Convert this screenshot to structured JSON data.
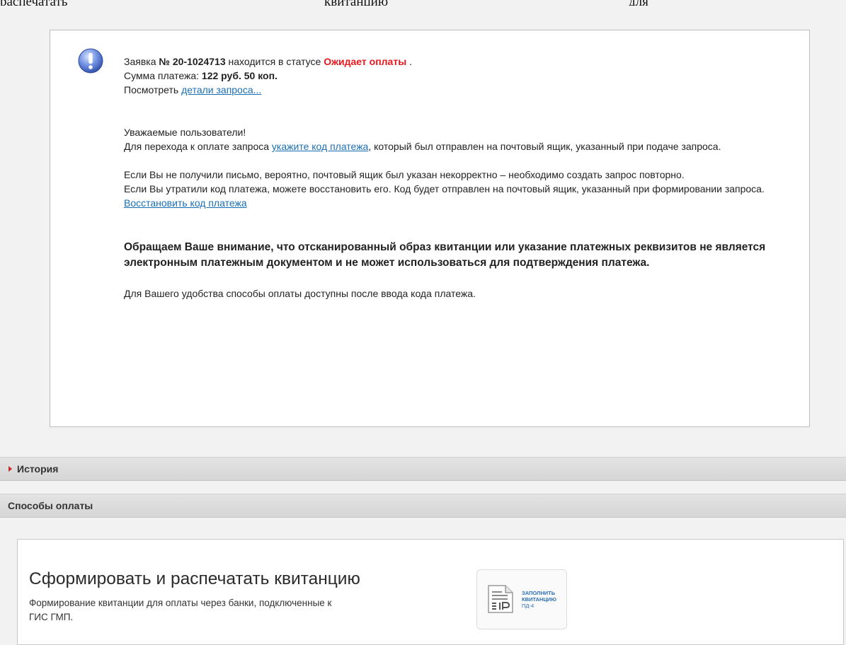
{
  "top_cut": {
    "w1": "распечатать",
    "w2": "квитанцию",
    "w3": "для"
  },
  "notice": {
    "icon": "exclamation-info-icon",
    "line1_pre": "Заявка ",
    "request_no": "№ 20-1024713",
    "line1_mid": " находится в статусе ",
    "status": "Ожидает оплаты",
    "line1_post": " .",
    "amount_label": "Сумма платежа: ",
    "amount": "122 руб. 50 коп.",
    "view_label": "Посмотреть ",
    "view_link": "детали запроса...",
    "greeting": "Уважаемые пользователи!",
    "p1_pre": "Для перехода к оплате запроса ",
    "p1_link": "укажите код платежа",
    "p1_post": ", который был отправлен на почтовый ящик, указанный при подаче запроса.",
    "p2": "Если Вы не получили письмо, вероятно, почтовый ящик был указан некорректно – необходимо создать запрос повторно.",
    "p3_pre": "Если Вы утратили код платежа, можете восстановить его. Код будет отправлен на почтовый ящик, указанный при формировании запроса. ",
    "p3_link": "Восстановить код платежа",
    "attention": "Обращаем Ваше внимание, что отсканированный образ квитанции или указание платежных реквизитов не является электронным платежным документом и не может использоваться для подтверждения платежа.",
    "note": "Для Вашего удобства способы оплаты доступны после ввода кода платежа."
  },
  "sections": {
    "history": "История",
    "payment": "Способы оплаты"
  },
  "payment_method": {
    "title": "Сформировать и распечатать квитанцию",
    "desc": "Формирование квитанции для оплаты через банки, подключенные к ГИС ГМП.",
    "button_line1": "Заполнить",
    "button_line2": "квитанцию",
    "button_line3": "ПД-4",
    "button_icon": "document-receipt-icon"
  }
}
